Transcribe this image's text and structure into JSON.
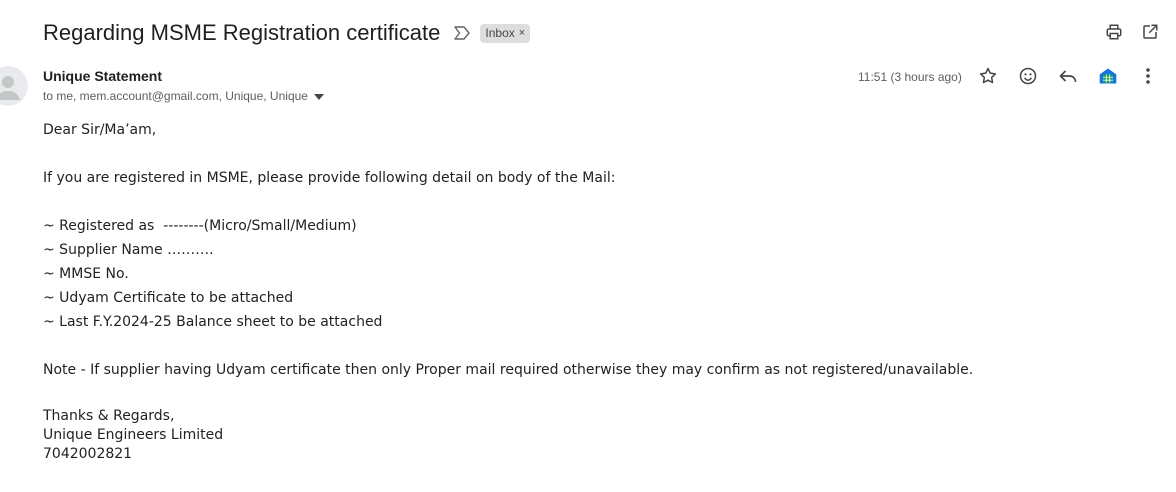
{
  "email": {
    "subject": "Regarding MSME Registration certificate",
    "label_chip": "Inbox",
    "label_chip_close": "×",
    "sender_name": "Unique Statement",
    "recipients": "to me, mem.account@gmail.com, Unique, Unique",
    "timestamp": "11:51 (3 hours ago)"
  },
  "body": {
    "greeting": "Dear Sir/Ma’am,",
    "intro": "If you are registered in MSME, please provide following detail on body of the Mail:",
    "items": [
      "~ Registered as  --------(Micro/Small/Medium)",
      "~ Supplier Name ……….",
      "~ MMSE No.",
      "~ Udyam Certificate to be attached",
      "~ Last F.Y.2024-25 Balance sheet to be attached"
    ],
    "note": "Note - If supplier having Udyam certificate then only Proper mail required otherwise they may confirm as not registered/unavailable.",
    "signature": [
      "Thanks & Regards,",
      "Unique Engineers Limited",
      "7042002821"
    ]
  },
  "icons": {
    "top": [
      "print-icon",
      "open-in-new-window-icon"
    ],
    "actions": [
      "star-icon",
      "emoji-reaction-icon",
      "reply-icon",
      "sheets-addon-icon",
      "more-options-icon"
    ],
    "accent": "#1a73e8",
    "sheets_green": "#0f9d58"
  }
}
